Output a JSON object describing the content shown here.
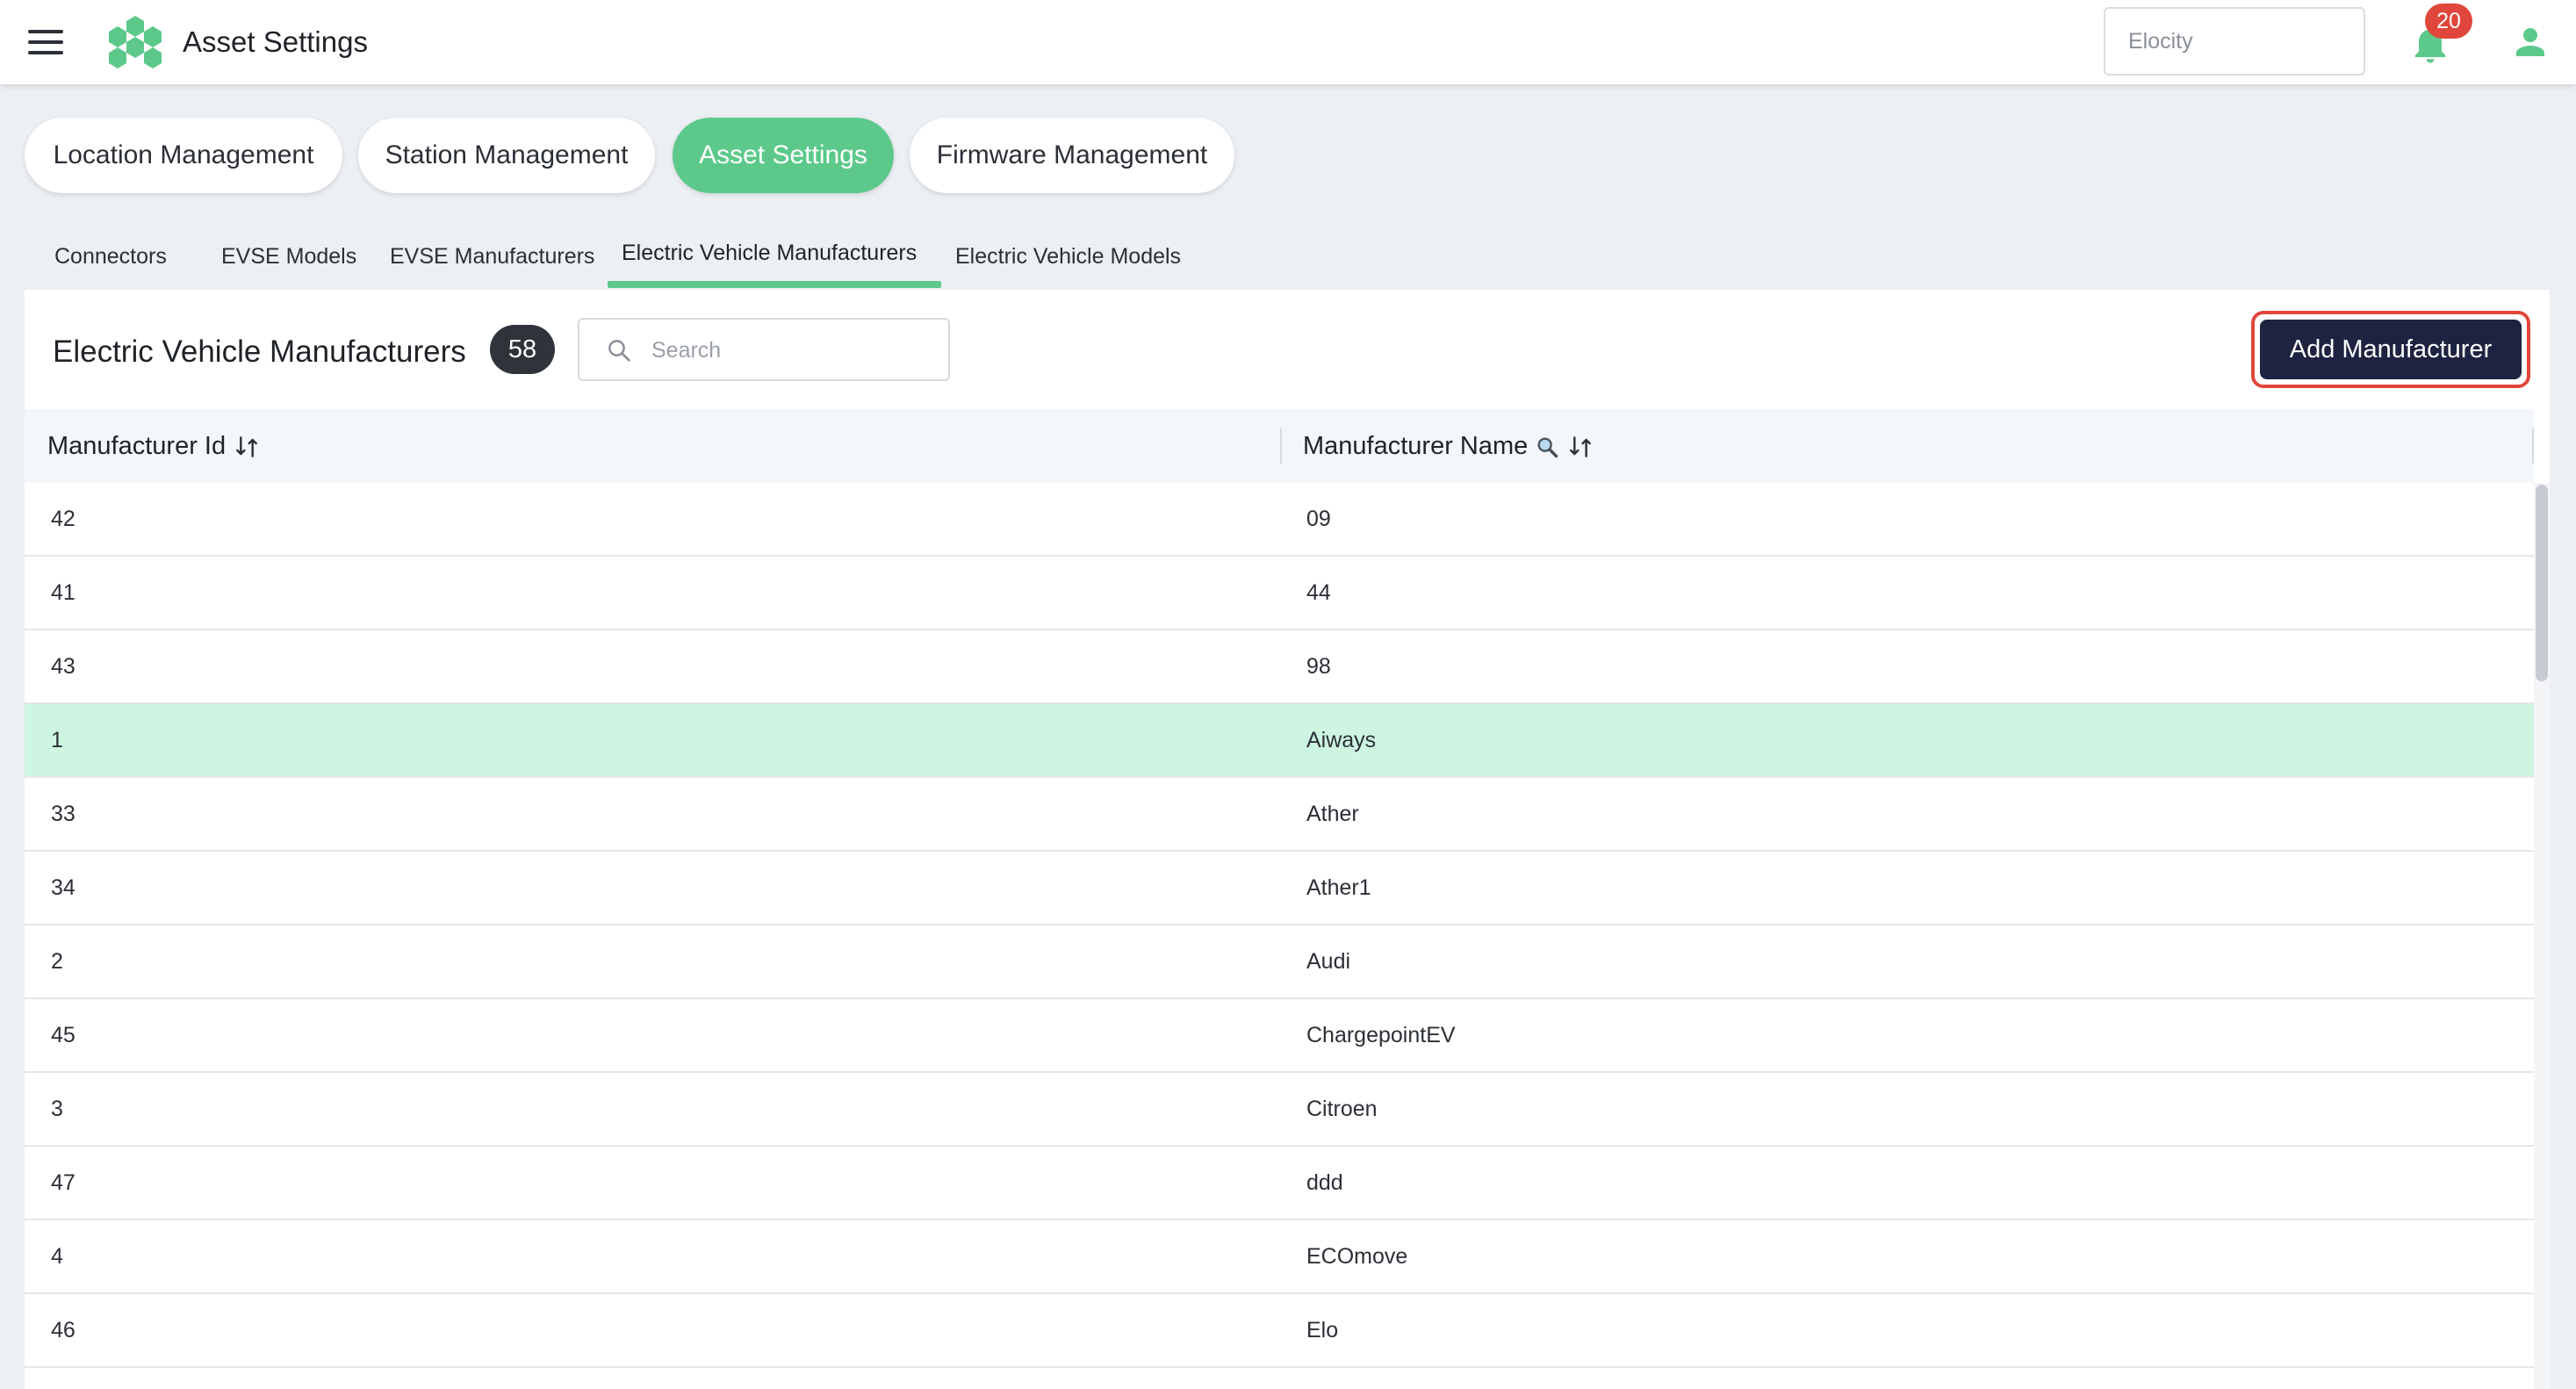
{
  "header": {
    "title": "Asset Settings",
    "org_selector_value": "Elocity",
    "notification_count": "20"
  },
  "primary_tabs": [
    {
      "label": "Location Management",
      "active": false
    },
    {
      "label": "Station Management",
      "active": false
    },
    {
      "label": "Asset Settings",
      "active": true
    },
    {
      "label": "Firmware Management",
      "active": false
    }
  ],
  "sub_tabs": [
    {
      "label": "Connectors",
      "active": false
    },
    {
      "label": "EVSE Models",
      "active": false
    },
    {
      "label": "EVSE Manufacturers",
      "active": false
    },
    {
      "label": "Electric Vehicle Manufacturers",
      "active": true
    },
    {
      "label": "Electric Vehicle Models",
      "active": false
    }
  ],
  "panel": {
    "title": "Electric Vehicle Manufacturers",
    "count": "58",
    "search_placeholder": "Search",
    "add_button_label": "Add Manufacturer"
  },
  "table": {
    "columns": [
      "Manufacturer Id",
      "Manufacturer Name"
    ],
    "rows": [
      {
        "id": "42",
        "name": "09",
        "highlight": false
      },
      {
        "id": "41",
        "name": "44",
        "highlight": false
      },
      {
        "id": "43",
        "name": "98",
        "highlight": false
      },
      {
        "id": "1",
        "name": "Aiways",
        "highlight": true
      },
      {
        "id": "33",
        "name": "Ather",
        "highlight": false
      },
      {
        "id": "34",
        "name": "Ather1",
        "highlight": false
      },
      {
        "id": "2",
        "name": "Audi",
        "highlight": false
      },
      {
        "id": "45",
        "name": "ChargepointEV",
        "highlight": false
      },
      {
        "id": "3",
        "name": "Citroen",
        "highlight": false
      },
      {
        "id": "47",
        "name": "ddd",
        "highlight": false
      },
      {
        "id": "4",
        "name": "ECOmove",
        "highlight": false
      },
      {
        "id": "46",
        "name": "Elo",
        "highlight": false
      },
      {
        "id": "",
        "name": "",
        "highlight": false
      }
    ]
  },
  "icons": {
    "menu": "hamburger-menu-icon",
    "logo": "hexagon-cluster-logo",
    "notifications": "bell-icon",
    "user": "user-icon",
    "search": "search-icon",
    "sort": "sort-arrows-icon",
    "filter": "magnifier-filter-icon"
  },
  "colors": {
    "accent_green": "#5cc98a",
    "highlight_row": "#cdf5e2",
    "primary_button": "#1d2340",
    "focus_ring": "#e0463b",
    "badge_red": "#e0463b"
  }
}
